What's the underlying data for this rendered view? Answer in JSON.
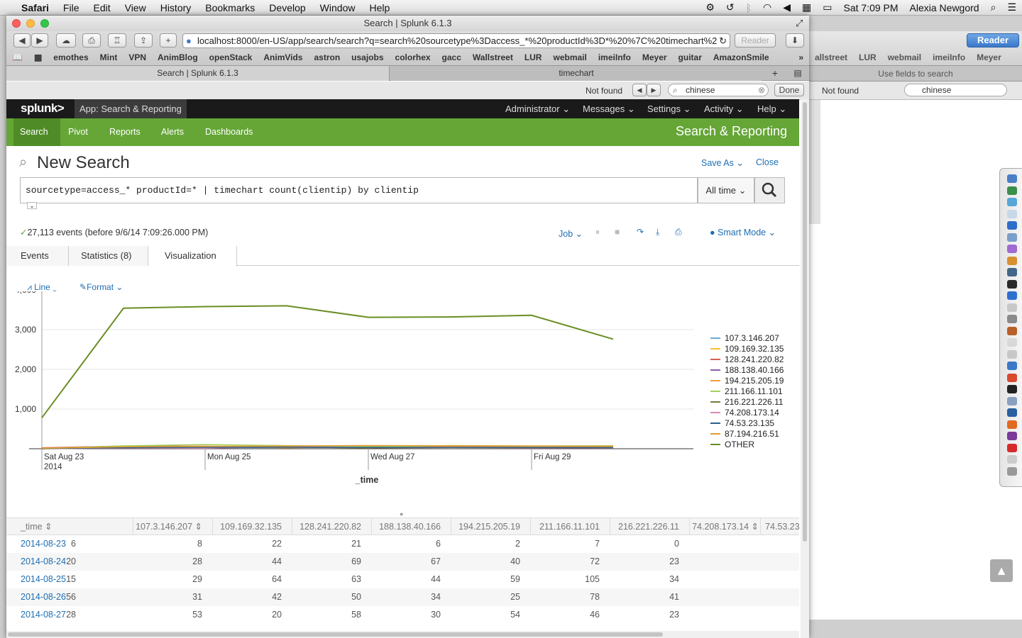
{
  "menubar": {
    "app": "Safari",
    "items": [
      "File",
      "Edit",
      "View",
      "History",
      "Bookmarks",
      "Develop",
      "Window",
      "Help"
    ],
    "clock": "Sat 7:09 PM",
    "user": "Alexia Newgord"
  },
  "window": {
    "title": "Search | Splunk 6.1.3",
    "url": "localhost:8000/en-US/app/search/search?q=search%20sourcetype%3Daccess_*%20productId%3D*%20%7C%20timechart%20c",
    "reader": "Reader"
  },
  "bookmarks": [
    "emothes",
    "Mint",
    "VPN",
    "AnimBlog",
    "openStack",
    "AnimVids",
    "astron",
    "usajobs",
    "colorhex",
    "gacc",
    "Wallstreet",
    "LUR",
    "webmail",
    "imeiInfo",
    "Meyer",
    "guitar",
    "AmazonSmile"
  ],
  "bg_bookmarks": [
    "allstreet",
    "LUR",
    "webmail",
    "imeiInfo",
    "Meyer"
  ],
  "tabs": {
    "left": "Search | Splunk 6.1.3",
    "right": "timechart",
    "bg": "Use fields to search"
  },
  "find": {
    "status": "Not found",
    "query": "chinese",
    "done": "Done"
  },
  "splunk": {
    "logo": "splunk>",
    "app": "App: Search & Reporting",
    "menus": [
      "Administrator",
      "Messages",
      "Settings",
      "Activity",
      "Help"
    ],
    "nav": [
      "Search",
      "Pivot",
      "Reports",
      "Alerts",
      "Dashboards"
    ],
    "app_title": "Search & Reporting"
  },
  "search": {
    "title": "New Search",
    "save_as": "Save As",
    "close": "Close",
    "query": "sourcetype=access_* productId=* | timechart count(clientip) by clientip",
    "time_range": "All time",
    "status": "27,113 events (before 9/6/14 7:09:26.000 PM)",
    "job": "Job",
    "mode": "Smart Mode"
  },
  "view_tabs": [
    "Events",
    "Statistics (8)",
    "Visualization"
  ],
  "viz": {
    "type_label": "Line",
    "format_label": "Format"
  },
  "chart_data": {
    "type": "line",
    "x": [
      "2014-08-23",
      "2014-08-24",
      "2014-08-25",
      "2014-08-26",
      "2014-08-27",
      "2014-08-28",
      "2014-08-29",
      "2014-08-30"
    ],
    "x_tick_labels": [
      "Sat Aug 23\n2014",
      "Mon Aug 25",
      "Wed Aug 27",
      "Fri Aug 29"
    ],
    "x_ticks_at": [
      "2014-08-23",
      "2014-08-25",
      "2014-08-27",
      "2014-08-29"
    ],
    "xlabel": "_time",
    "ylim": [
      0,
      4000
    ],
    "yticks": [
      1000,
      2000,
      3000,
      4000
    ],
    "ytick_labels": [
      "1,000",
      "2,000",
      "3,000",
      "4,000"
    ],
    "legend_position": "right",
    "series": [
      {
        "name": "107.3.146.207",
        "color": "#6baed6",
        "values": [
          8,
          28,
          29,
          31,
          53,
          40,
          35,
          30
        ]
      },
      {
        "name": "109.169.32.135",
        "color": "#f2c12e",
        "values": [
          22,
          44,
          64,
          42,
          20,
          45,
          50,
          40
        ]
      },
      {
        "name": "128.241.220.82",
        "color": "#d6604d",
        "values": [
          21,
          69,
          63,
          50,
          58,
          60,
          55,
          50
        ]
      },
      {
        "name": "188.138.40.166",
        "color": "#8c5fa8",
        "values": [
          6,
          67,
          44,
          34,
          30,
          45,
          40,
          35
        ]
      },
      {
        "name": "194.215.205.19",
        "color": "#f39c3c",
        "values": [
          2,
          40,
          59,
          25,
          54,
          50,
          45,
          40
        ]
      },
      {
        "name": "211.166.11.101",
        "color": "#a4d05a",
        "values": [
          7,
          72,
          105,
          78,
          46,
          80,
          70,
          75
        ]
      },
      {
        "name": "216.221.226.11",
        "color": "#7a7a3a",
        "values": [
          0,
          23,
          34,
          41,
          23,
          30,
          28,
          25
        ]
      },
      {
        "name": "74.208.173.14",
        "color": "#d98cb3",
        "values": [
          6,
          20,
          15,
          56,
          28,
          30,
          25,
          20
        ]
      },
      {
        "name": "74.53.23.135",
        "color": "#2b5f8f",
        "values": [
          5,
          30,
          35,
          40,
          30,
          35,
          30,
          28
        ]
      },
      {
        "name": "87.194.216.51",
        "color": "#e0a030",
        "values": [
          10,
          50,
          60,
          70,
          80,
          75,
          70,
          65
        ]
      },
      {
        "name": "OTHER",
        "color": "#6b8e23",
        "values": [
          780,
          3540,
          3580,
          3600,
          3310,
          3320,
          3360,
          2760
        ]
      }
    ]
  },
  "table": {
    "columns": [
      "_time",
      "107.3.146.207",
      "109.169.32.135",
      "128.241.220.82",
      "188.138.40.166",
      "194.215.205.19",
      "211.166.11.101",
      "216.221.226.11",
      "74.208.173.14",
      "74.53.23"
    ],
    "rows": [
      [
        "2014-08-23",
        "8",
        "22",
        "21",
        "6",
        "2",
        "7",
        "0",
        "6"
      ],
      [
        "2014-08-24",
        "28",
        "44",
        "69",
        "67",
        "40",
        "72",
        "23",
        "20"
      ],
      [
        "2014-08-25",
        "29",
        "64",
        "63",
        "44",
        "59",
        "105",
        "34",
        "15"
      ],
      [
        "2014-08-26",
        "31",
        "42",
        "50",
        "34",
        "25",
        "78",
        "41",
        "56"
      ],
      [
        "2014-08-27",
        "53",
        "20",
        "58",
        "30",
        "54",
        "46",
        "23",
        "28"
      ]
    ]
  }
}
